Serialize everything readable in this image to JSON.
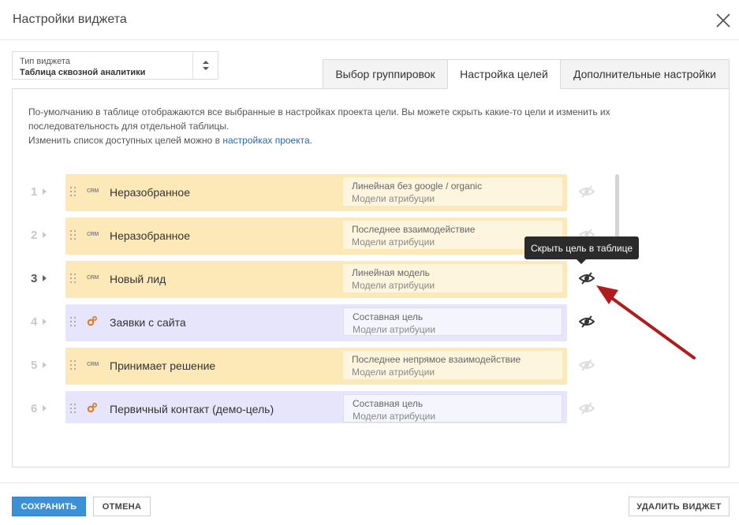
{
  "dialog": {
    "title": "Настройки виджета"
  },
  "widget_type": {
    "label": "Тип виджета",
    "value": "Таблица сквозной аналитики"
  },
  "tabs": [
    {
      "label": "Выбор группировок",
      "active": false
    },
    {
      "label": "Настройка целей",
      "active": true
    },
    {
      "label": "Дополнительные настройки",
      "active": false
    }
  ],
  "info": {
    "line1": "По-умолчанию в таблице отображаются все выбранные в настройках проекта цели. Вы можете скрыть какие-то цели и изменить их последовательность для отдельной таблицы.",
    "line2_prefix": "Изменить список доступных целей можно в ",
    "line2_link": "настройках проекта",
    "line2_suffix": "."
  },
  "goals": [
    {
      "num": "1",
      "icon": "crm-icon",
      "icon_text": "CRM",
      "kind": "crm",
      "name": "Неразобранное",
      "model": "Линейная без google / organic",
      "sub": "Модели атрибуции",
      "hidden_state": "visible"
    },
    {
      "num": "2",
      "icon": "crm-icon",
      "icon_text": "CRM",
      "kind": "crm",
      "name": "Неразобранное",
      "model": "Последнее взаимодействие",
      "sub": "Модели атрибуции",
      "hidden_state": "visible"
    },
    {
      "num": "3",
      "icon": "crm-icon",
      "icon_text": "CRM",
      "kind": "crm",
      "name": "Новый лид",
      "model": "Линейная модель",
      "sub": "Модели атрибуции",
      "hidden_state": "hover"
    },
    {
      "num": "4",
      "icon": "gear-icon",
      "icon_text": "",
      "kind": "comp",
      "name": "Заявки с сайта",
      "model": "Составная цель",
      "sub": "Модели атрибуции",
      "hidden_state": "hidden"
    },
    {
      "num": "5",
      "icon": "crm-icon",
      "icon_text": "CRM",
      "kind": "crm",
      "name": "Принимает решение",
      "model": "Последнее непрямое взаимодействие",
      "sub": "Модели атрибуции",
      "hidden_state": "visible"
    },
    {
      "num": "6",
      "icon": "gear-icon",
      "icon_text": "",
      "kind": "comp",
      "name": "Первичный контакт (демо-цель)",
      "model": "Составная цель",
      "sub": "Модели атрибуции",
      "hidden_state": "visible"
    }
  ],
  "tooltip": {
    "text": "Скрыть цель в таблице"
  },
  "footer": {
    "save": "СОХРАНИТЬ",
    "cancel": "ОТМЕНА",
    "delete": "УДАЛИТЬ ВИДЖЕТ"
  },
  "colors": {
    "crm_card": "#fde9b8",
    "composite_card": "#e6e5fb",
    "primary": "#3d8fd6",
    "annotation_arrow": "#b01c1c"
  }
}
